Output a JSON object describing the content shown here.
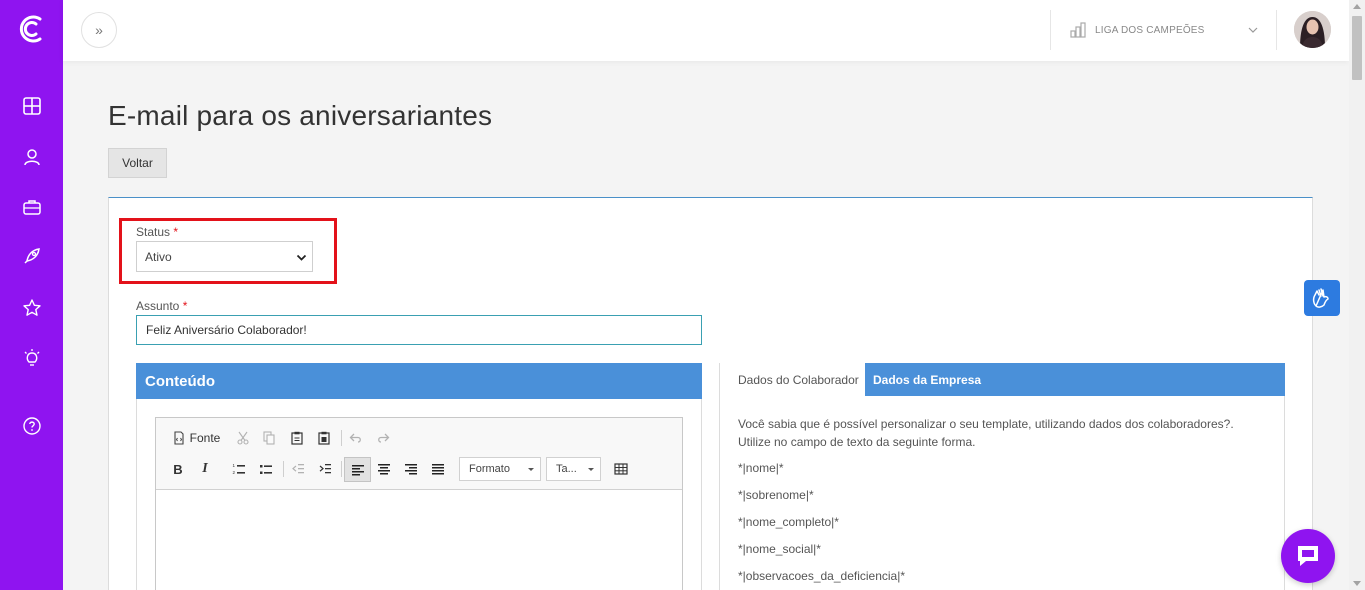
{
  "header": {
    "expand_label": "»",
    "company_name": "LIGA DOS CAMPEÕES"
  },
  "sidebar": {
    "items": [
      {
        "icon": "dashboard-icon"
      },
      {
        "icon": "user-icon"
      },
      {
        "icon": "briefcase-icon"
      },
      {
        "icon": "rocket-icon"
      },
      {
        "icon": "star-icon"
      },
      {
        "icon": "lightbulb-icon"
      },
      {
        "icon": "help-icon"
      }
    ],
    "accent_color": "#8f14f0"
  },
  "main": {
    "title": "E-mail para os aniversariantes",
    "back_label": "Voltar",
    "status": {
      "label": "Status",
      "required_mark": "*",
      "value": "Ativo"
    },
    "subject": {
      "label": "Assunto",
      "required_mark": "*",
      "value": "Feliz Aniversário Colaborador!"
    },
    "content_panel": {
      "title": "Conteúdo",
      "toolbar": {
        "source_label": "Fonte",
        "format_label": "Formato",
        "size_label": "Ta..."
      }
    },
    "data_panel": {
      "tabs": [
        "Dados do Colaborador",
        "Dados da Empresa"
      ],
      "intro": "Você sabia que é possível personalizar o seu template, utilizando dados dos colaboradores?. Utilize no campo de texto da seguinte forma.",
      "variables": [
        "*|nome|*",
        "*|sobrenome|*",
        "*|nome_completo|*",
        "*|nome_social|*",
        "*|observacoes_da_deficiencia|*"
      ]
    }
  },
  "colors": {
    "panel_blue": "#4a90d9",
    "highlight_red": "#e3121a",
    "a11y_blue": "#2d7be0"
  }
}
